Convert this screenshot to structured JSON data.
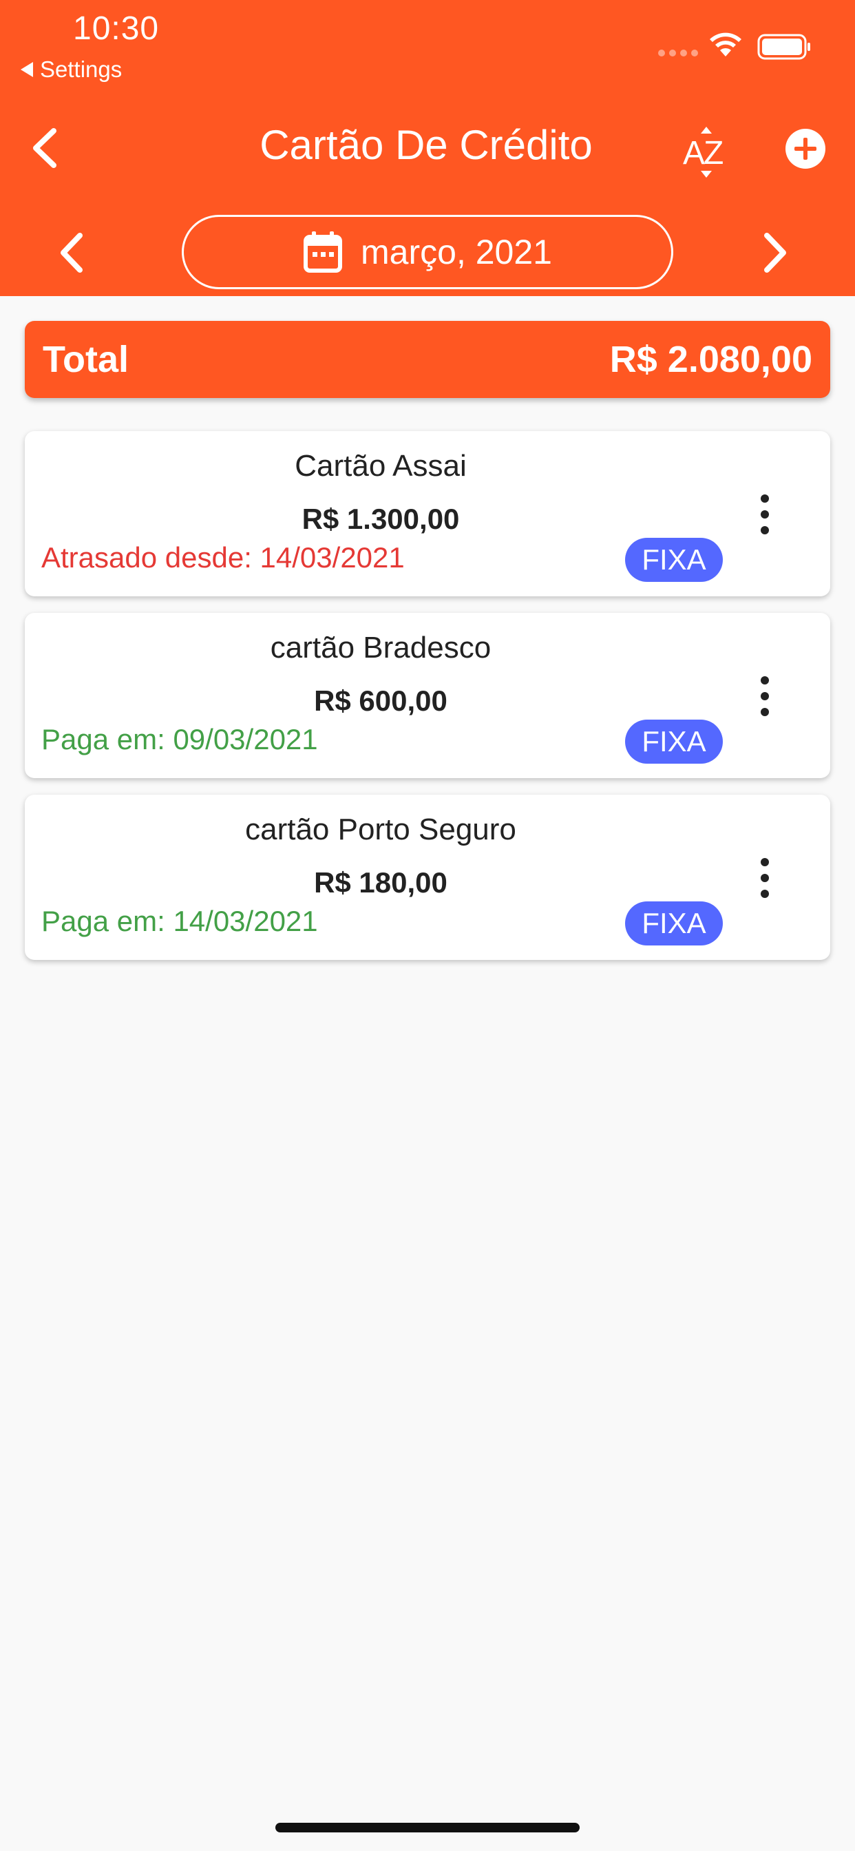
{
  "status_bar": {
    "time": "10:30",
    "back_app_label": "Settings"
  },
  "header": {
    "title": "Cartão De Crédito",
    "sort_icon": "sort-az-icon",
    "add_icon": "add-circle-icon",
    "back_icon": "chevron-left-icon"
  },
  "month_selector": {
    "label": "março, 2021",
    "calendar_icon": "calendar-icon"
  },
  "total": {
    "label": "Total",
    "value": "R$ 2.080,00"
  },
  "cards": [
    {
      "name": "Cartão Assai",
      "amount": "R$ 1.300,00",
      "status": "Atrasado desde: 14/03/2021",
      "status_type": "late",
      "badge": "FIXA"
    },
    {
      "name": "cartão Bradesco",
      "amount": "R$ 600,00",
      "status": "Paga em: 09/03/2021",
      "status_type": "paid",
      "badge": "FIXA"
    },
    {
      "name": "cartão Porto Seguro",
      "amount": "R$ 180,00",
      "status": "Paga em: 14/03/2021",
      "status_type": "paid",
      "badge": "FIXA"
    }
  ],
  "colors": {
    "primary": "#ff5722",
    "badge": "#5468ff",
    "late": "#e53935",
    "paid": "#43a047"
  }
}
